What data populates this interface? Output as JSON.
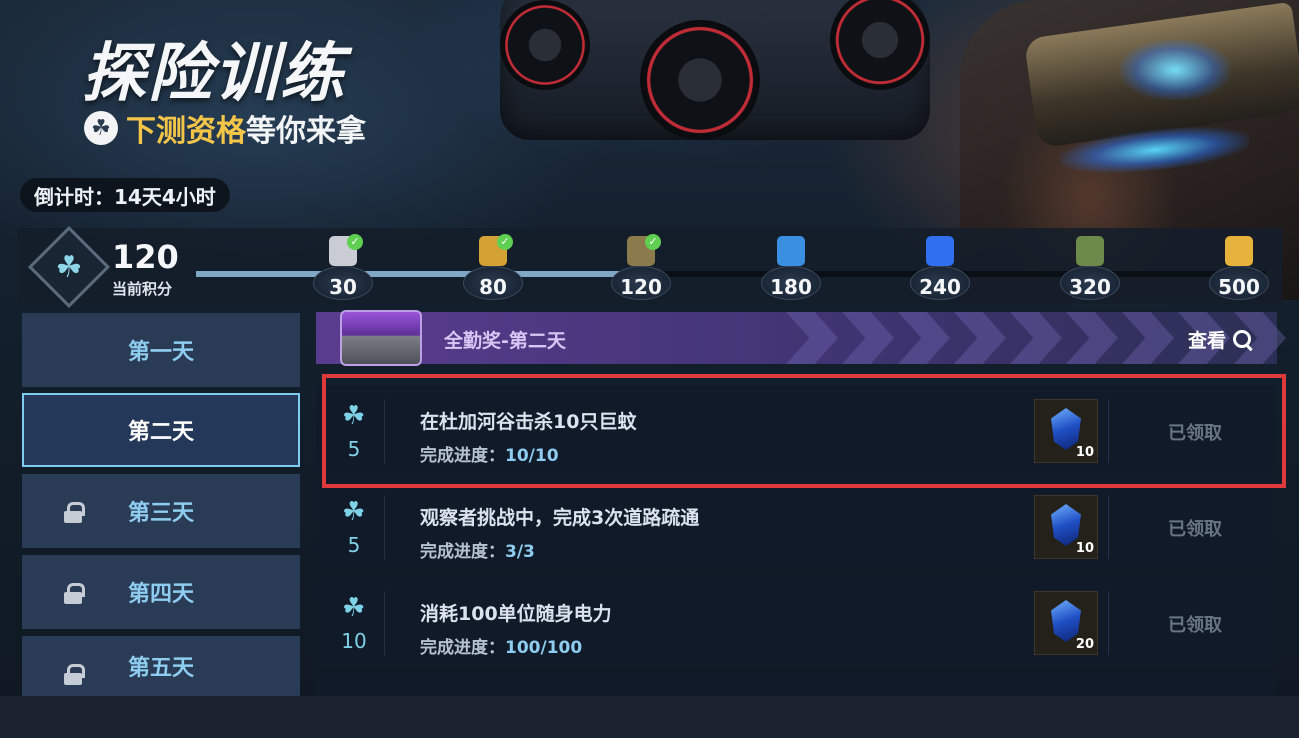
{
  "header": {
    "title": "探险训练",
    "subtitle_highlight": "下测资格",
    "subtitle_rest": "等你来拿",
    "subtitle_icon": "clover-icon",
    "countdown": "倒计时：14天4小时"
  },
  "score": {
    "value": "120",
    "label": "当前积分",
    "icon": "clover-icon"
  },
  "progress": {
    "current": 120,
    "max": 500,
    "milestones": [
      {
        "value": "30",
        "icon": "robot-icon",
        "claimed": true,
        "color": "#c9ccd2"
      },
      {
        "value": "80",
        "icon": "mystery-box-icon",
        "claimed": true,
        "color": "#d4a135"
      },
      {
        "value": "120",
        "icon": "rifle-icon",
        "claimed": true,
        "color": "#8b7a4c"
      },
      {
        "value": "180",
        "icon": "blue-card-icon",
        "claimed": false,
        "color": "#3a8fe0"
      },
      {
        "value": "240",
        "icon": "blue-gem-icon",
        "claimed": false,
        "color": "#2f6ff0"
      },
      {
        "value": "320",
        "icon": "vehicle-icon",
        "claimed": false,
        "color": "#6e8a4a"
      },
      {
        "value": "500",
        "icon": "gold-coin-icon",
        "claimed": false,
        "color": "#e6b23c"
      }
    ]
  },
  "days": [
    {
      "label": "第一天",
      "active": false,
      "locked": false
    },
    {
      "label": "第二天",
      "active": true,
      "locked": false
    },
    {
      "label": "第三天",
      "active": false,
      "locked": true
    },
    {
      "label": "第四天",
      "active": false,
      "locked": true
    },
    {
      "label": "第五天",
      "active": false,
      "locked": true
    }
  ],
  "banner": {
    "title": "全勤奖-第二天",
    "view_label": "查看"
  },
  "tasks": [
    {
      "points": "5",
      "name": "在杜加河谷击杀10只巨蚊",
      "progress_label": "完成进度：",
      "progress_value": "10/10",
      "reward_count": "10",
      "status": "已领取"
    },
    {
      "points": "5",
      "name": "观察者挑战中，完成3次道路疏通",
      "progress_label": "完成进度：",
      "progress_value": "3/3",
      "reward_count": "10",
      "status": "已领取"
    },
    {
      "points": "10",
      "name": "消耗100单位随身电力",
      "progress_label": "完成进度：",
      "progress_value": "100/100",
      "reward_count": "20",
      "status": "已领取"
    }
  ],
  "colors": {
    "accent_cyan": "#7ecdf0",
    "highlight_red": "#e0393b",
    "gold": "#f3c64a"
  }
}
